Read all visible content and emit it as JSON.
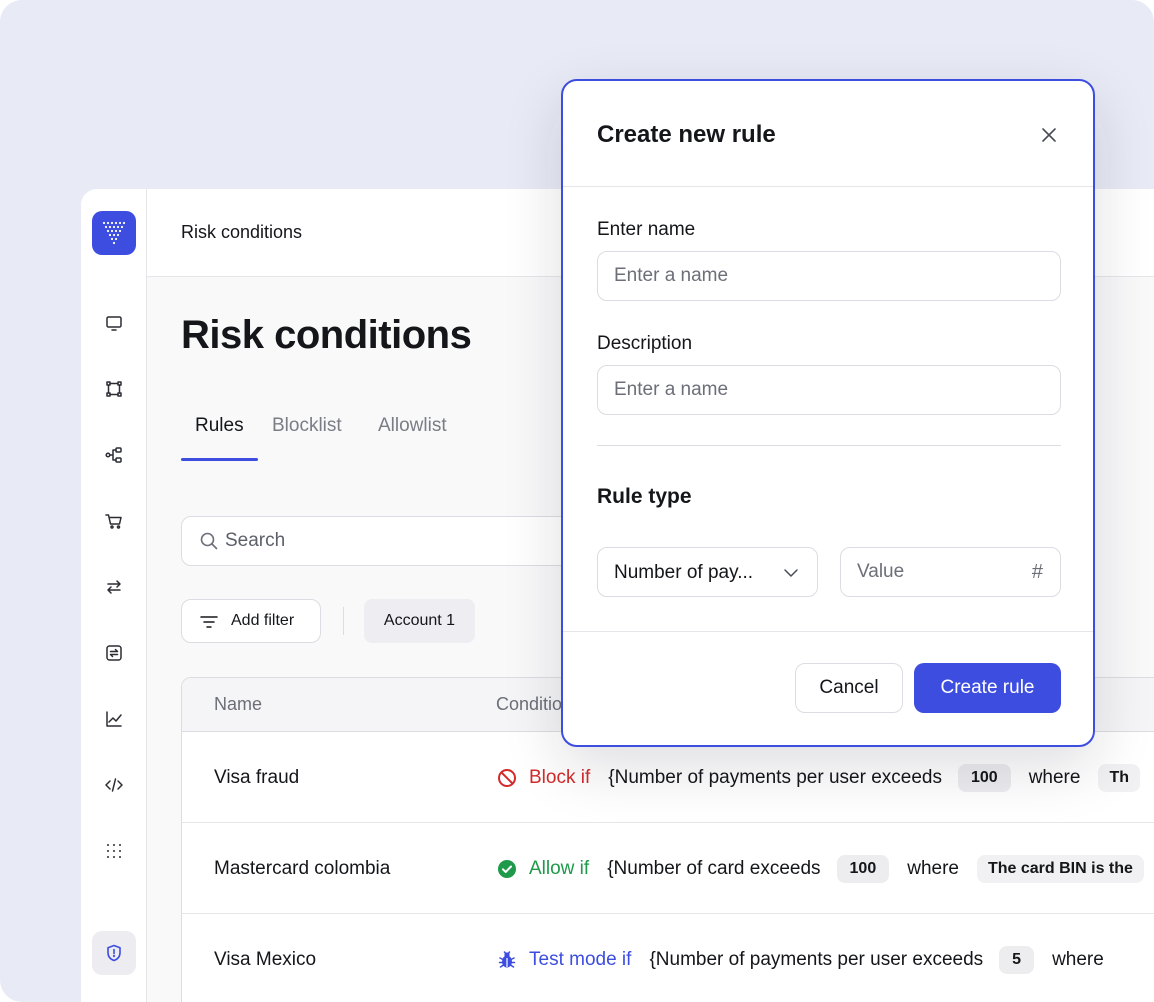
{
  "colors": {
    "accent": "#3d4de0",
    "block": "#d42a2a",
    "allow": "#1e9a4a",
    "test": "#3d4de0",
    "backdrop": "#e8eaf5"
  },
  "sidebar": {
    "items": [
      {
        "icon": "monitor-icon"
      },
      {
        "icon": "nodes-icon"
      },
      {
        "icon": "flow-icon"
      },
      {
        "icon": "cart-icon"
      },
      {
        "icon": "transfer-icon"
      },
      {
        "icon": "exchange-icon"
      },
      {
        "icon": "chart-icon"
      },
      {
        "icon": "code-icon"
      },
      {
        "icon": "grid-icon"
      }
    ],
    "footer_icon": "shield-icon"
  },
  "header": {
    "title": "Risk conditions"
  },
  "main": {
    "title": "Risk conditions",
    "tabs": [
      {
        "label": "Rules",
        "active": true
      },
      {
        "label": "Blocklist",
        "active": false
      },
      {
        "label": "Allowlist",
        "active": false
      }
    ],
    "search": {
      "placeholder": "Search"
    },
    "add_filter_label": "Add filter",
    "account_chip": "Account 1"
  },
  "table": {
    "columns": [
      "Name",
      "Conditions"
    ],
    "rows": [
      {
        "name": "Visa fraud",
        "status": "block",
        "verb": "Block if",
        "condition": "{Number of payments per user exceeds",
        "value": "100",
        "where": "where",
        "extra": "Th"
      },
      {
        "name": "Mastercard colombia",
        "status": "allow",
        "verb": "Allow if",
        "condition": "{Number of card exceeds",
        "value": "100",
        "where": "where",
        "extra": "The card BIN is the"
      },
      {
        "name": "Visa Mexico",
        "status": "test",
        "verb": "Test mode if",
        "condition": "{Number of payments per user exceeds",
        "value": "5",
        "where": "where",
        "extra": ""
      }
    ]
  },
  "modal": {
    "title": "Create new rule",
    "name_label": "Enter name",
    "name_placeholder": "Enter a name",
    "description_label": "Description",
    "description_placeholder": "Enter a name",
    "rule_type_title": "Rule type",
    "rule_type_selected": "Number of pay...",
    "value_placeholder": "Value",
    "value_symbol": "#",
    "cancel_label": "Cancel",
    "create_label": "Create rule"
  }
}
